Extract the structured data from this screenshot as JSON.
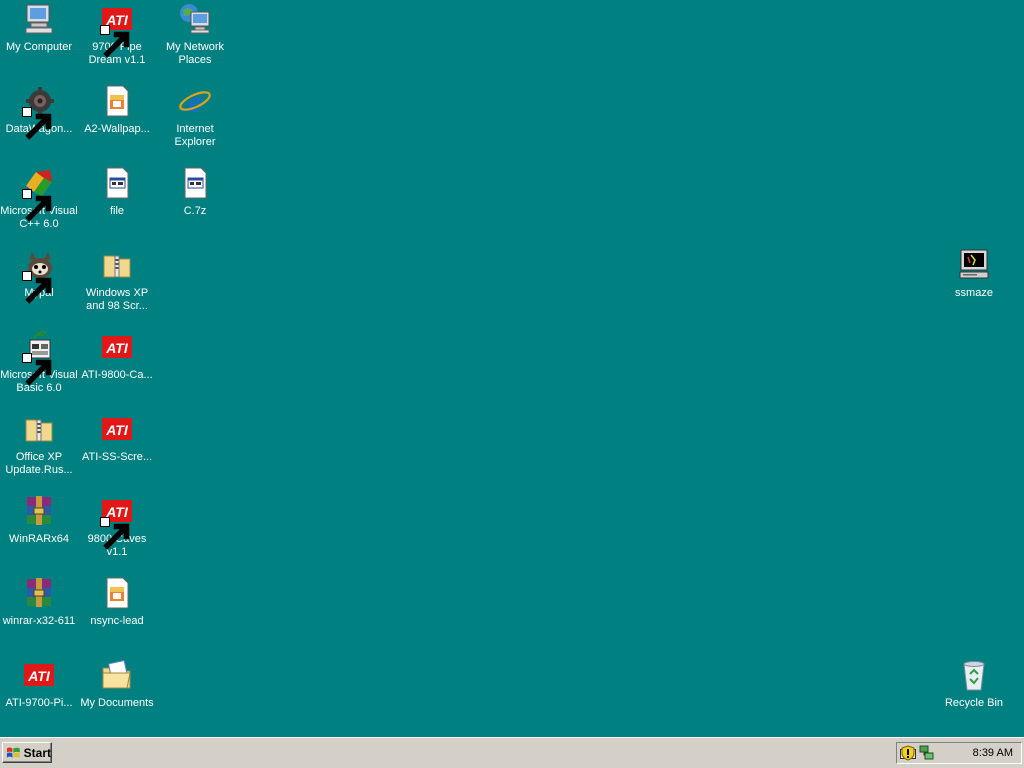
{
  "desktop": {
    "background_color": "#008080",
    "icons": [
      {
        "label": "My Computer",
        "icon": "my-computer-icon",
        "shortcut": false
      },
      {
        "label": "9700 Pipe\nDream v1.1",
        "icon": "ati-logo-icon",
        "shortcut": true
      },
      {
        "label": "My Network\nPlaces",
        "icon": "network-places-icon",
        "shortcut": false
      },
      {
        "label": "DataWagon...",
        "icon": "gear-icon",
        "shortcut": true
      },
      {
        "label": "A2-Wallpap...",
        "icon": "image-file-icon",
        "shortcut": false
      },
      {
        "label": "Internet\nExplorer",
        "icon": "internet-explorer-icon",
        "shortcut": false
      },
      {
        "label": "Microsoft Visual\nC++ 6.0",
        "icon": "visual-cpp-icon",
        "shortcut": true
      },
      {
        "label": "file",
        "icon": "generic-file-icon",
        "shortcut": false
      },
      {
        "label": "C.7z",
        "icon": "generic-file-icon",
        "shortcut": false
      },
      {
        "label": "Mypal",
        "icon": "mypal-icon",
        "shortcut": true
      },
      {
        "label": "Windows XP\nand 98 Scr...",
        "icon": "zip-folder-icon",
        "shortcut": false
      },
      {
        "label": "Microsoft Visual\nBasic 6.0",
        "icon": "visual-basic-icon",
        "shortcut": true
      },
      {
        "label": "ATI-9800-Ca...",
        "icon": "ati-logo-icon",
        "shortcut": false
      },
      {
        "label": "Office XP\nUpdate.Rus...",
        "icon": "zip-folder-icon",
        "shortcut": false
      },
      {
        "label": "ATI-SS-Scre...",
        "icon": "ati-logo-icon",
        "shortcut": false
      },
      {
        "label": "WinRARx64",
        "icon": "winrar-icon",
        "shortcut": false
      },
      {
        "label": "9800 Caves\nv1.1",
        "icon": "ati-logo-icon",
        "shortcut": true
      },
      {
        "label": "winrar-x32-611",
        "icon": "winrar-icon",
        "shortcut": false
      },
      {
        "label": "nsync-lead",
        "icon": "image-file-icon",
        "shortcut": false
      },
      {
        "label": "ATI-9700-Pi...",
        "icon": "ati-logo-icon",
        "shortcut": false
      },
      {
        "label": "My Documents",
        "icon": "my-documents-icon",
        "shortcut": false
      },
      {
        "label": "ssmaze",
        "icon": "screensaver-icon",
        "shortcut": false
      },
      {
        "label": "Recycle Bin",
        "icon": "recycle-bin-icon",
        "shortcut": false
      }
    ]
  },
  "taskbar": {
    "start_label": "Start",
    "tray_icons": [
      "keyboard-icon",
      "security-shield-icon",
      "network-icon"
    ],
    "clock": "8:39 AM"
  }
}
